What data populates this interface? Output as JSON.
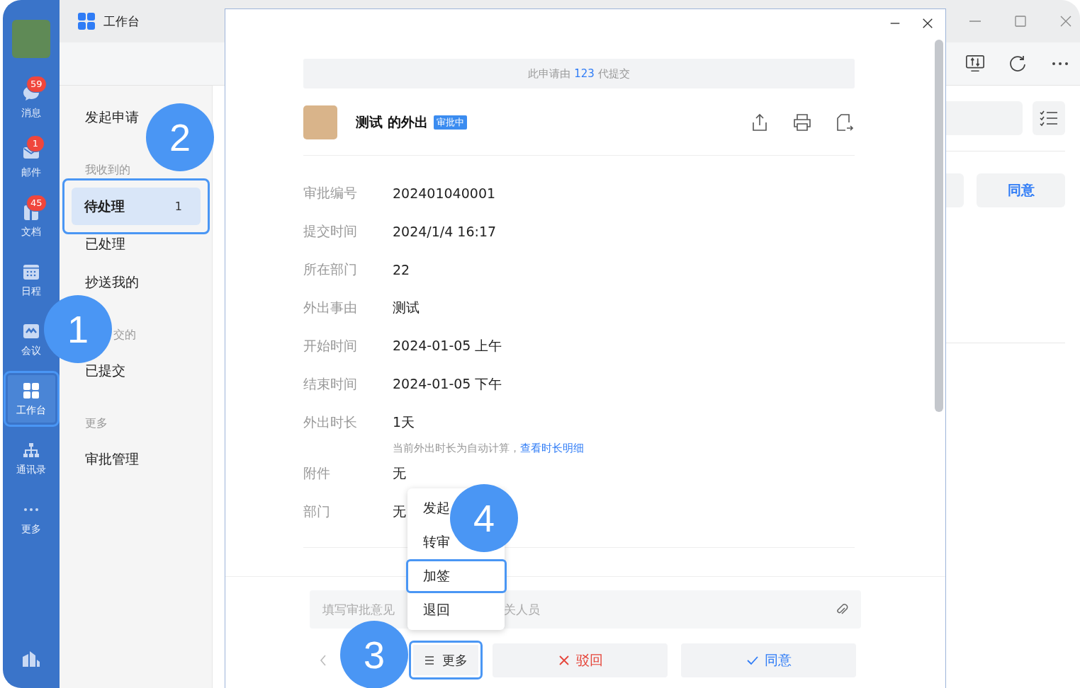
{
  "nav": {
    "items": [
      {
        "label": "消息",
        "badge": "59",
        "selected": false,
        "highlighted": false
      },
      {
        "label": "邮件",
        "badge": "1",
        "selected": false,
        "highlighted": false
      },
      {
        "label": "文档",
        "badge": "45",
        "selected": false,
        "highlighted": false
      },
      {
        "label": "日程",
        "selected": false,
        "highlighted": false
      },
      {
        "label": "会议",
        "selected": false,
        "highlighted": false
      },
      {
        "label": "工作台",
        "selected": true,
        "highlighted": true
      },
      {
        "label": "通讯录",
        "selected": false,
        "highlighted": false
      },
      {
        "label": "更多",
        "selected": false,
        "highlighted": false
      }
    ]
  },
  "header": {
    "title": "工作台"
  },
  "sidebar": {
    "items": [
      {
        "kind": "item",
        "label": "发起申请",
        "selected": false,
        "highlighted": false
      },
      {
        "kind": "section",
        "label": "我收到的"
      },
      {
        "kind": "item",
        "label": "待处理",
        "count": "1",
        "selected": true,
        "highlighted": true
      },
      {
        "kind": "item",
        "label": "已处理",
        "selected": false,
        "highlighted": false
      },
      {
        "kind": "item",
        "label": "抄送我的",
        "selected": false,
        "highlighted": false
      },
      {
        "kind": "section",
        "label": "交的"
      },
      {
        "kind": "item",
        "label": "已提交",
        "selected": false,
        "highlighted": false
      },
      {
        "kind": "section",
        "label": "更多"
      },
      {
        "kind": "item",
        "label": "审批管理",
        "selected": false,
        "highlighted": false
      }
    ]
  },
  "background_panel": {
    "agree_button": "同意"
  },
  "dialog": {
    "notice": {
      "before": "此申请由",
      "name": "123",
      "after": "代提交"
    },
    "title": "测试 的外出",
    "status": "审批中",
    "fields": [
      {
        "label": "审批编号",
        "value": "202401040001"
      },
      {
        "label": "提交时间",
        "value": "2024/1/4 16:17"
      },
      {
        "label": "所在部门",
        "value": "22"
      },
      {
        "label": "外出事由",
        "value": "测试"
      },
      {
        "label": "开始时间",
        "value": "2024-01-05 上午"
      },
      {
        "label": "结束时间",
        "value": "2024-01-05 下午"
      },
      {
        "label": "外出时长",
        "value": "1天",
        "note": "当前外出时长为自动计算，",
        "note_link": "查看时长明细"
      },
      {
        "label": "附件",
        "value": "无"
      },
      {
        "label": "部门",
        "value": "无"
      }
    ],
    "comment": {
      "placeholder_parts": [
        "填写审批意见",
        "关人员"
      ]
    },
    "more_button": {
      "label": "更多",
      "highlighted": true
    },
    "reject_button": "驳回",
    "agree_button": "同意",
    "menu": [
      {
        "label": "发起",
        "highlighted": false
      },
      {
        "label": "转审",
        "highlighted": false
      },
      {
        "label": "加签",
        "highlighted": true
      },
      {
        "label": "退回",
        "highlighted": false
      }
    ]
  },
  "callouts": [
    {
      "number": "1"
    },
    {
      "number": "2"
    },
    {
      "number": "3"
    },
    {
      "number": "4"
    }
  ]
}
